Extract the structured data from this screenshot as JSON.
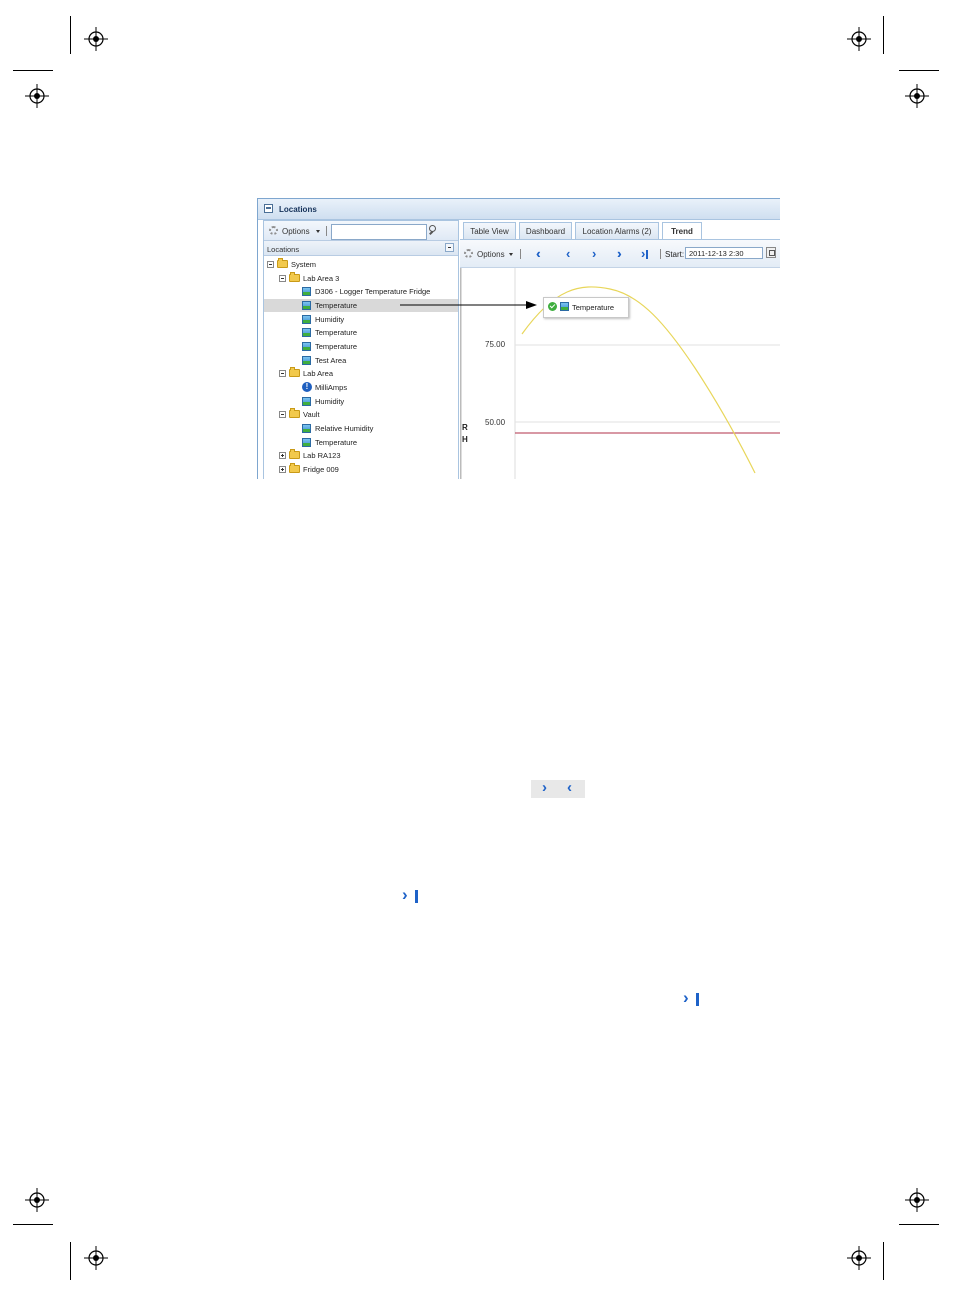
{
  "window": {
    "title": "Locations"
  },
  "left_panel": {
    "options_label": "Options",
    "search_placeholder": "",
    "header": "Locations",
    "tree": [
      {
        "label": "System",
        "type": "folder"
      },
      {
        "label": "Lab Area 3",
        "type": "folder"
      },
      {
        "label": "D306 - Logger Temperature Fridge",
        "type": "sensor"
      },
      {
        "label": "Temperature",
        "type": "sensor",
        "selected": true
      },
      {
        "label": "Humidity",
        "type": "sensor"
      },
      {
        "label": "Temperature",
        "type": "sensor"
      },
      {
        "label": "Temperature",
        "type": "sensor"
      },
      {
        "label": "Test Area",
        "type": "sensor"
      },
      {
        "label": "Lab Area",
        "type": "folder"
      },
      {
        "label": "MilliAmps",
        "type": "alarm"
      },
      {
        "label": "Humidity",
        "type": "sensor"
      },
      {
        "label": "Vault",
        "type": "folder"
      },
      {
        "label": "Relative Humidity",
        "type": "sensor"
      },
      {
        "label": "Temperature",
        "type": "sensor"
      },
      {
        "label": "Lab RA123",
        "type": "folder"
      },
      {
        "label": "Fridge 009",
        "type": "folder"
      }
    ]
  },
  "right_panel": {
    "tabs": [
      {
        "label": "Table View"
      },
      {
        "label": "Dashboard"
      },
      {
        "label": "Location Alarms (2)"
      },
      {
        "label": "Trend",
        "active": true
      }
    ],
    "options_label": "Options",
    "nav_icons": [
      "double-chevron-left-icon",
      "chevron-left-icon",
      "chevron-right-icon",
      "double-chevron-right-icon",
      "skip-to-end-icon"
    ],
    "start_label": "Start:",
    "start_value": "2011-12-13 2:30"
  },
  "chart": {
    "y_ticks": [
      "75.00",
      "50.00"
    ],
    "y_axis_label": [
      "R",
      "H"
    ],
    "tooltip_label": "Temperature",
    "series_color": "#e8d65a",
    "threshold_color": "#b0304a",
    "accent": "#1e62c8"
  },
  "icons": [
    "chevron-right-icon",
    "chevron-left-icon",
    "skip-to-end-icon"
  ]
}
